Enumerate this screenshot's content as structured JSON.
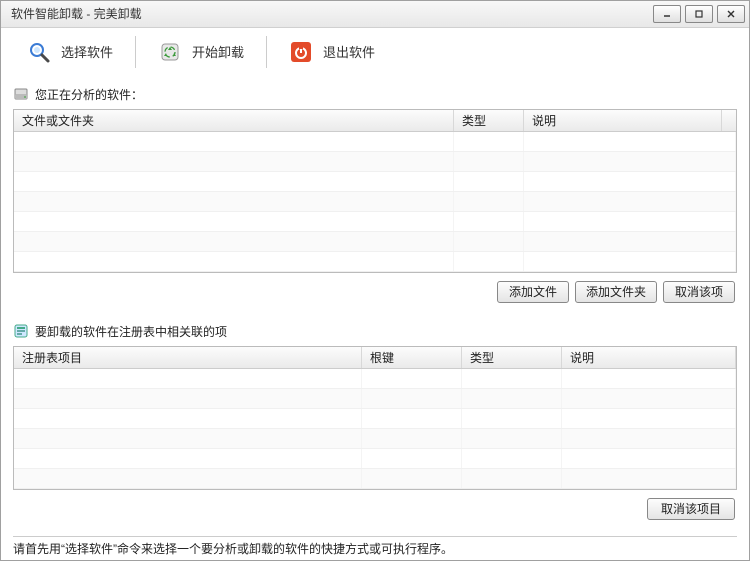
{
  "window": {
    "title": "软件智能卸载 - 完美卸载"
  },
  "toolbar": {
    "select_software": "选择软件",
    "start_uninstall": "开始卸载",
    "exit_software": "退出软件"
  },
  "section1": {
    "title": "您正在分析的软件：",
    "columns": {
      "file": "文件或文件夹",
      "type": "类型",
      "desc": "说明"
    }
  },
  "buttons1": {
    "add_file": "添加文件",
    "add_folder": "添加文件夹",
    "cancel_item": "取消该项"
  },
  "section2": {
    "title": "要卸载的软件在注册表中相关联的项",
    "columns": {
      "reg": "注册表项目",
      "root": "根键",
      "type": "类型",
      "desc": "说明"
    }
  },
  "buttons2": {
    "cancel_item": "取消该项目"
  },
  "status": {
    "text": "请首先用“选择软件”命令来选择一个要分析或卸载的软件的快捷方式或可执行程序。"
  }
}
